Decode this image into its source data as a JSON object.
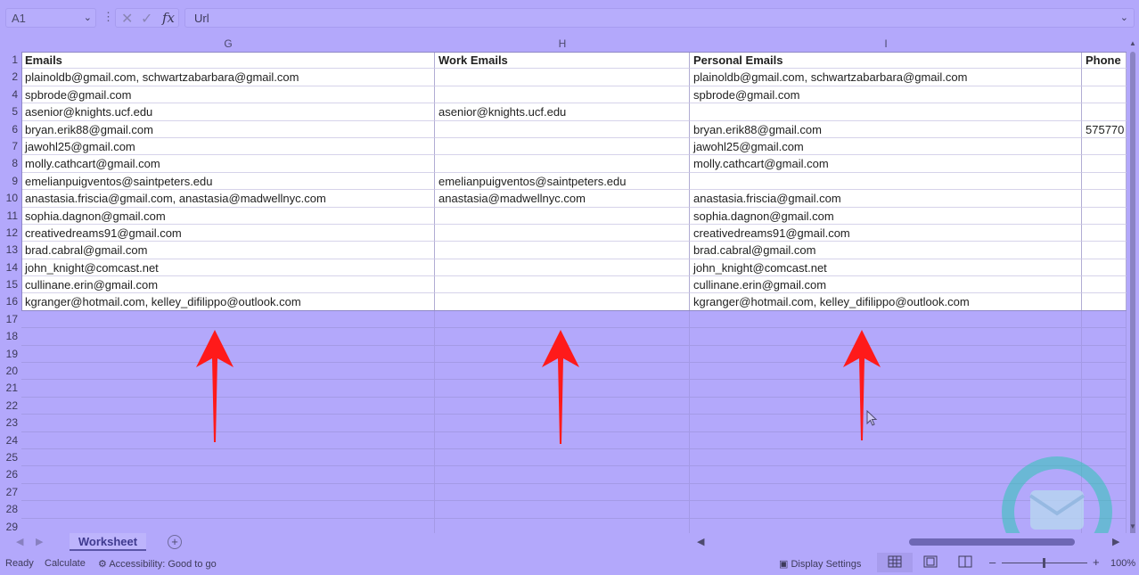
{
  "formula_bar": {
    "name_box": "A1",
    "formula": "Url"
  },
  "columns": [
    {
      "letter": "G"
    },
    {
      "letter": "H"
    },
    {
      "letter": "I"
    }
  ],
  "rows": [
    {
      "num": "1",
      "cells": [
        "Emails",
        "Work Emails",
        "Personal Emails",
        "Phone"
      ]
    },
    {
      "num": "2",
      "cells": [
        "plainoldb@gmail.com, schwartzabarbara@gmail.com",
        "",
        "plainoldb@gmail.com, schwartzabarbara@gmail.com",
        ""
      ]
    },
    {
      "num": "4",
      "cells": [
        "spbrode@gmail.com",
        "",
        "spbrode@gmail.com",
        ""
      ]
    },
    {
      "num": "5",
      "cells": [
        "asenior@knights.ucf.edu",
        "asenior@knights.ucf.edu",
        "",
        ""
      ]
    },
    {
      "num": "6",
      "cells": [
        "bryan.erik88@gmail.com",
        "",
        "bryan.erik88@gmail.com",
        "575770"
      ]
    },
    {
      "num": "7",
      "cells": [
        "jawohl25@gmail.com",
        "",
        "jawohl25@gmail.com",
        ""
      ]
    },
    {
      "num": "8",
      "cells": [
        "molly.cathcart@gmail.com",
        "",
        "molly.cathcart@gmail.com",
        ""
      ]
    },
    {
      "num": "9",
      "cells": [
        "emelianpuigventos@saintpeters.edu",
        "emelianpuigventos@saintpeters.edu",
        "",
        ""
      ]
    },
    {
      "num": "10",
      "cells": [
        "anastasia.friscia@gmail.com, anastasia@madwellnyc.com",
        "anastasia@madwellnyc.com",
        "anastasia.friscia@gmail.com",
        ""
      ]
    },
    {
      "num": "11",
      "cells": [
        "sophia.dagnon@gmail.com",
        "",
        "sophia.dagnon@gmail.com",
        ""
      ]
    },
    {
      "num": "12",
      "cells": [
        "creativedreams91@gmail.com",
        "",
        "creativedreams91@gmail.com",
        ""
      ]
    },
    {
      "num": "13",
      "cells": [
        "brad.cabral@gmail.com",
        "",
        "brad.cabral@gmail.com",
        ""
      ]
    },
    {
      "num": "14",
      "cells": [
        "john_knight@comcast.net",
        "",
        "john_knight@comcast.net",
        ""
      ]
    },
    {
      "num": "15",
      "cells": [
        "cullinane.erin@gmail.com",
        "",
        "cullinane.erin@gmail.com",
        ""
      ]
    },
    {
      "num": "16",
      "cells": [
        "kgranger@hotmail.com, kelley_difilippo@outlook.com",
        "",
        "kgranger@hotmail.com, kelley_difilippo@outlook.com",
        ""
      ]
    },
    {
      "num": "17",
      "cells": [
        "",
        "",
        "",
        ""
      ]
    },
    {
      "num": "18",
      "cells": [
        "",
        "",
        "",
        ""
      ]
    },
    {
      "num": "19",
      "cells": [
        "",
        "",
        "",
        ""
      ]
    },
    {
      "num": "20",
      "cells": [
        "",
        "",
        "",
        ""
      ]
    },
    {
      "num": "21",
      "cells": [
        "",
        "",
        "",
        ""
      ]
    },
    {
      "num": "22",
      "cells": [
        "",
        "",
        "",
        ""
      ]
    },
    {
      "num": "23",
      "cells": [
        "",
        "",
        "",
        ""
      ]
    },
    {
      "num": "24",
      "cells": [
        "",
        "",
        "",
        ""
      ]
    },
    {
      "num": "25",
      "cells": [
        "",
        "",
        "",
        ""
      ]
    },
    {
      "num": "26",
      "cells": [
        "",
        "",
        "",
        ""
      ]
    },
    {
      "num": "27",
      "cells": [
        "",
        "",
        "",
        ""
      ]
    },
    {
      "num": "28",
      "cells": [
        "",
        "",
        "",
        ""
      ]
    },
    {
      "num": "29",
      "cells": [
        "",
        "",
        "",
        ""
      ]
    }
  ],
  "sheet_tabs": {
    "active": "Worksheet"
  },
  "status_bar": {
    "ready": "Ready",
    "calculate": "Calculate",
    "accessibility": "Accessibility: Good to go",
    "display_settings": "Display Settings",
    "zoom": "100%"
  },
  "icons": {
    "arrow_color": "#ff1a1a",
    "logo_color": "#2ec4b6"
  }
}
